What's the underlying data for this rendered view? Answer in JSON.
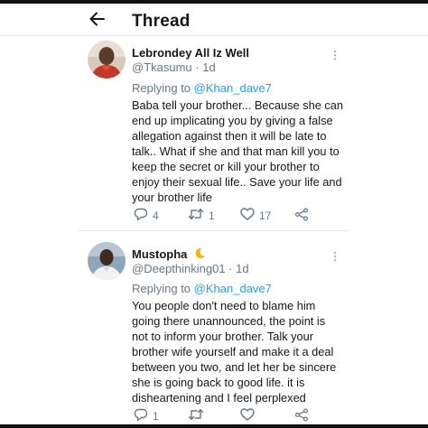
{
  "header": {
    "title": "Thread"
  },
  "tweets": [
    {
      "name": "Lebrondey All Iz Well",
      "handle": "@Tkasumu",
      "separator": "·",
      "time": "1d",
      "replying_prefix": "Replying to",
      "replying_to": "@Khan_dave7",
      "body_lines": [
        "Baba tell your brother... Because she can",
        "end up implicating you by giving a false",
        "allegation against then it will be late to",
        "talk.. What if she and that man kill you to",
        "keep the secret or kill your brother to",
        "enjoy their sexual life.. Save your life and",
        "your brother life"
      ],
      "replies": "4",
      "retweets": "1",
      "likes": "17"
    },
    {
      "name": "Mustopha",
      "name_emoji": "crescent-moon-icon",
      "handle": "@Deepthinking01",
      "separator": "·",
      "time": "1d",
      "replying_prefix": "Replying to",
      "replying_to": "@Khan_dave7",
      "body_lines": [
        "You people don't need to blame him",
        "going there unannounced, the point is",
        "not to inform your brother. Talk your",
        "brother wife yourself and make it a deal",
        "between you two, and let her be sincere",
        "she is going back to good life. it is",
        "disheartening and I feel  perplexed"
      ],
      "replies": "1",
      "retweets": "",
      "likes": ""
    }
  ],
  "colors": {
    "text": "#14171a",
    "secondary": "#657786",
    "link": "#1da1f2",
    "divider": "#e1e8ed",
    "moon": "#f5b400"
  }
}
